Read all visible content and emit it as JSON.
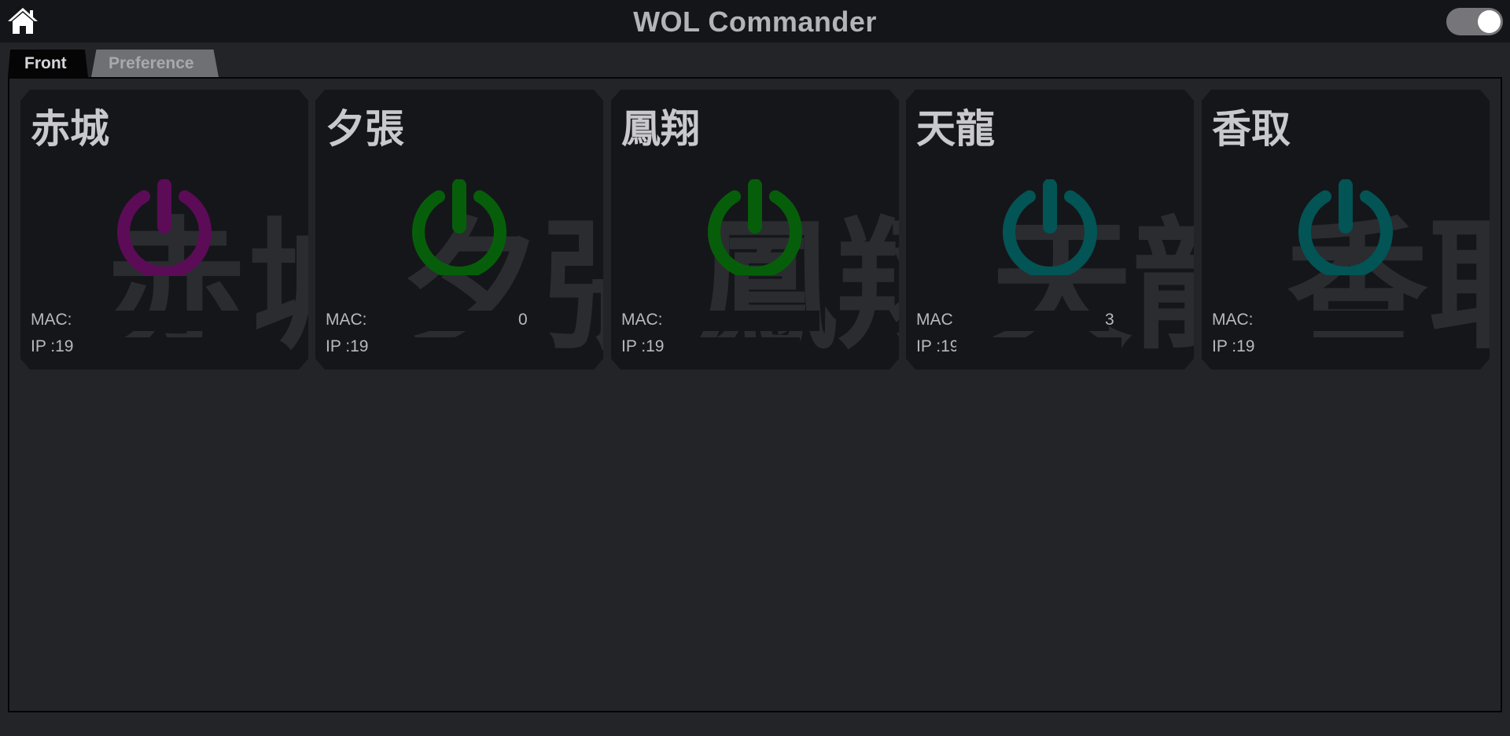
{
  "header": {
    "title": "WOL Commander",
    "home_icon": "home-icon",
    "toggle_state": "on"
  },
  "tabs": [
    {
      "label": "Front",
      "active": true
    },
    {
      "label": "Preference",
      "active": false
    }
  ],
  "cards": [
    {
      "name": "赤城",
      "background_text": "赤城",
      "mac_label": "MAC:",
      "ip_label": "IP :19",
      "power_color": "#5c0b57",
      "icon": "power-icon"
    },
    {
      "name": "夕張",
      "background_text": "夕張",
      "mac_label": "MAC:",
      "mac_tail": "0",
      "ip_label": "IP :19",
      "power_color": "#075e0a",
      "icon": "power-icon"
    },
    {
      "name": "鳳翔",
      "background_text": "鳳翔",
      "mac_label": "MAC:",
      "ip_label": "IP :19",
      "power_color": "#075e0a",
      "icon": "power-icon"
    },
    {
      "name": "天龍",
      "background_text": "天龍",
      "mac_label": "MAC",
      "mac_tail": "3",
      "ip_label": "IP :19",
      "power_color": "#035455",
      "icon": "power-icon"
    },
    {
      "name": "香取",
      "background_text": "香取",
      "mac_label": "MAC:",
      "ip_label": "IP :19",
      "power_color": "#035455",
      "icon": "power-icon"
    }
  ],
  "colors": {
    "header_bg": "#141519",
    "page_bg": "#232427",
    "card_bg": "#15161a",
    "active_tab_bg": "#050506",
    "inactive_tab_bg": "#6f7074"
  }
}
